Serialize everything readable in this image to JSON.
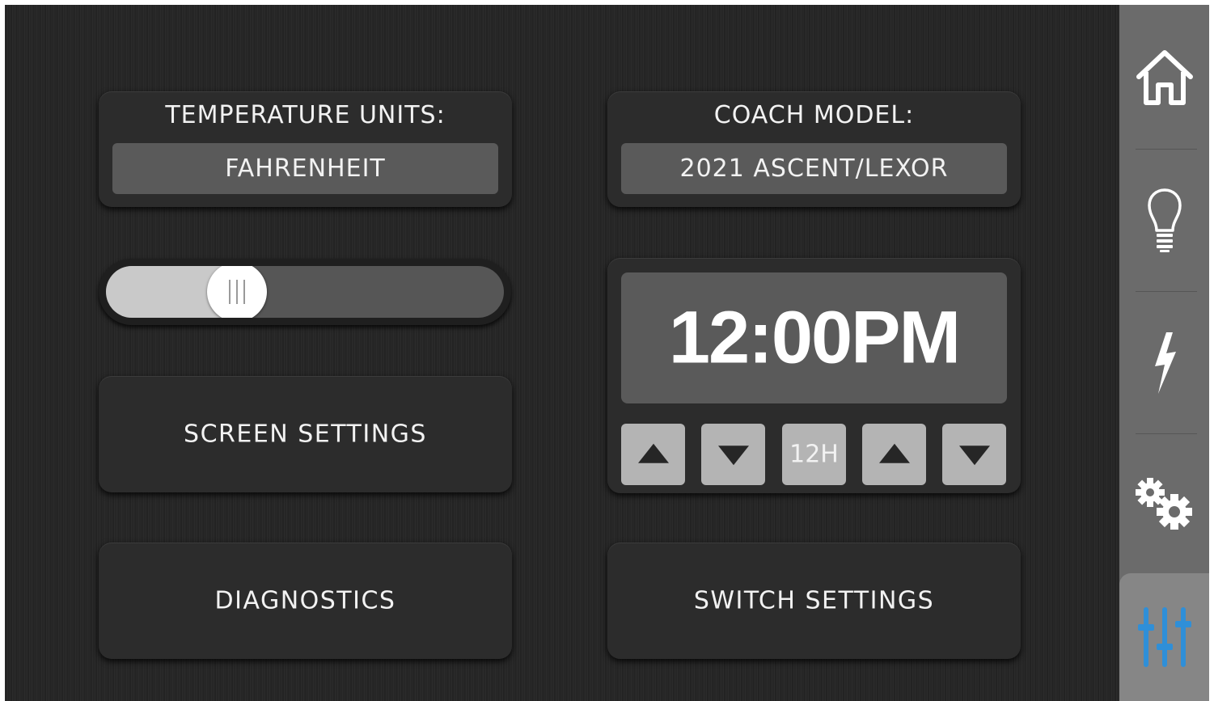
{
  "temperature_units": {
    "title": "TEMPERATURE UNITS:",
    "value": "FAHRENHEIT"
  },
  "coach_model": {
    "title": "COACH MODEL:",
    "value": "2021 ASCENT/LEXOR"
  },
  "brightness_slider": {
    "value_fraction": 0.33
  },
  "clock": {
    "time": "12:00PM",
    "hour_up_icon": "triangle-up",
    "hour_down_icon": "triangle-down",
    "format_label": "12H",
    "minute_up_icon": "triangle-up",
    "minute_down_icon": "triangle-down"
  },
  "buttons": {
    "screen_settings": "SCREEN SETTINGS",
    "diagnostics": "DIAGNOSTICS",
    "switch_settings": "SWITCH SETTINGS"
  },
  "sidebar": {
    "items": [
      {
        "icon": "home-icon",
        "active": false
      },
      {
        "icon": "lightbulb-icon",
        "active": false
      },
      {
        "icon": "lightning-icon",
        "active": false
      },
      {
        "icon": "gears-icon",
        "active": false
      },
      {
        "icon": "sliders-icon",
        "active": true
      }
    ]
  },
  "colors": {
    "background": "#262626",
    "panel": "#2c2c2c",
    "value_box": "#5a5a5a",
    "sidebar": "#6b6b6b",
    "sidebar_active": "#868686",
    "accent_blue": "#2f8fd8",
    "text": "#f2f2f2"
  }
}
